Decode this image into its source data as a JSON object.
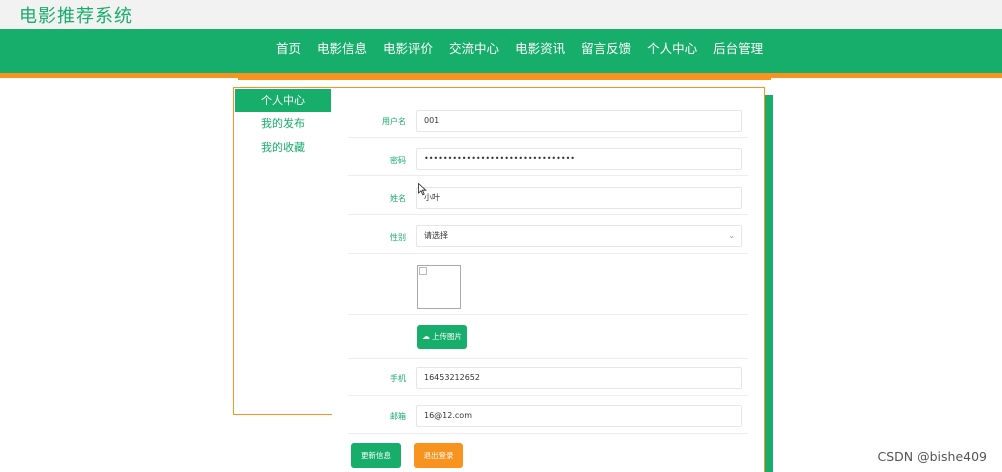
{
  "site": {
    "title": "电影推荐系统"
  },
  "nav": {
    "items": [
      "首页",
      "电影信息",
      "电影评价",
      "交流中心",
      "电影资讯",
      "留言反馈",
      "个人中心",
      "后台管理"
    ]
  },
  "sidebar": {
    "items": [
      {
        "label": "个人中心",
        "active": true
      },
      {
        "label": "我的发布",
        "active": false
      },
      {
        "label": "我的收藏",
        "active": false
      }
    ]
  },
  "form": {
    "username": {
      "label": "用户名",
      "value": "001"
    },
    "password": {
      "label": "密码",
      "value": "••••••••••••••••••••••••••••••••"
    },
    "name": {
      "label": "姓名",
      "value": "小叶"
    },
    "gender": {
      "label": "性别",
      "value": "请选择"
    },
    "upload_label": "上传图片",
    "phone": {
      "label": "手机",
      "value": "16453212652"
    },
    "email": {
      "label": "邮箱",
      "value": "16@12.com"
    }
  },
  "actions": {
    "update_label": "更新信息",
    "logout_label": "退出登录"
  },
  "watermark": "CSDN @bishe409",
  "colors": {
    "primary": "#17ad6a",
    "accent": "#f7931e"
  },
  "icons": {
    "upload": "cloud-upload-icon",
    "select": "chevron-down-icon",
    "cursor": "mouse-pointer-icon"
  }
}
